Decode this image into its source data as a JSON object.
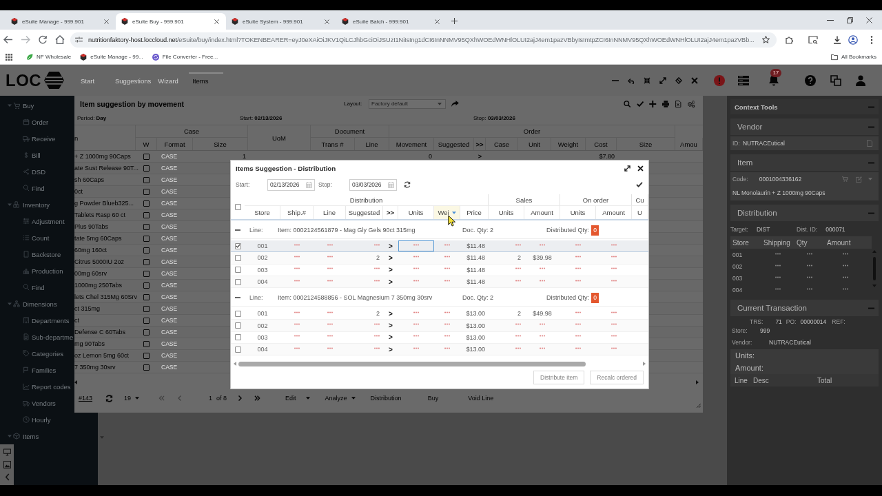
{
  "browser": {
    "tabs": [
      {
        "title": "eSuite Manage - 999:901",
        "selected": false
      },
      {
        "title": "eSuite Buy - 999:901",
        "selected": true
      },
      {
        "title": "eSuite System - 999:901",
        "selected": false
      },
      {
        "title": "eSuite Batch - 999:901",
        "selected": false
      }
    ],
    "address": {
      "host": "nutritionfaktory-host.loccloud.net",
      "path": "/eSuite/buy/index.html?TOKENBEARER=eyJ0eXAiOiJKV1QiLCJhbGciOiJSUzI1NiIsIng1dCI6InNNMV95QXhWOEdWNHlOLUI2ajJ4em1pazVBbyIsImtpZCI6InNNMV95QXhWOEdWNHlOLUI2ajJ4em1pazVBb..."
    },
    "bookmarks": [
      {
        "label": "NF Wholesale",
        "kind": "leaf"
      },
      {
        "label": "eSuite Manage - 99...",
        "kind": "hexagon"
      },
      {
        "label": "File Converter - Free...",
        "kind": "arrows"
      }
    ],
    "all_bookmarks": "All Bookmarks"
  },
  "app": {
    "logo": "LOC",
    "notification_count": "17"
  },
  "sidebar": [
    {
      "label": "Buy",
      "expanded": true,
      "children": [
        {
          "label": "Order"
        },
        {
          "label": "Receive"
        },
        {
          "label": "Bill"
        },
        {
          "label": "DSD"
        },
        {
          "label": "Find"
        }
      ]
    },
    {
      "label": "Inventory",
      "expanded": true,
      "children": [
        {
          "label": "Adjustment"
        },
        {
          "label": "Count"
        },
        {
          "label": "Backstore"
        },
        {
          "label": "Production"
        },
        {
          "label": "Find"
        }
      ]
    },
    {
      "label": "Dimensions",
      "expanded": true,
      "children": [
        {
          "label": "Departments"
        },
        {
          "label": "Sub-departme"
        },
        {
          "label": "Categories"
        },
        {
          "label": "Families"
        },
        {
          "label": "Report codes"
        },
        {
          "label": "Vendors"
        },
        {
          "label": "Hourly"
        }
      ]
    },
    {
      "label": "Items",
      "expanded": true
    }
  ],
  "window": {
    "tabs": [
      {
        "label": "Start",
        "selected": false
      },
      {
        "label": "Suggestions",
        "selected": false
      },
      {
        "label": "Wizard",
        "selected": false
      },
      {
        "label": "Items",
        "selected": true
      }
    ],
    "title": "Item suggestion by movement",
    "layout": {
      "label": "Layout:",
      "value": "Factory default",
      "disabled": true
    },
    "period": {
      "label": "Period:",
      "value": "Day"
    },
    "start": {
      "label": "Start:",
      "value": "02/13/2026"
    },
    "stop": {
      "label": "Stop:",
      "value": "03/03/2026"
    },
    "table": {
      "columns": [
        {
          "label": "n"
        },
        {
          "label": "Case",
          "children": [
            {
              "label": "W"
            },
            {
              "label": "Format"
            },
            {
              "label": "Size"
            }
          ]
        },
        {
          "label": "UoM"
        },
        {
          "label": "Document",
          "children": [
            {
              "label": "Trans #"
            },
            {
              "label": "Line"
            }
          ]
        },
        {
          "label": "Order",
          "children": [
            {
              "label": "Movement"
            },
            {
              "label": "Suggested"
            },
            {
              "label": ">>"
            },
            {
              "label": "Case"
            },
            {
              "label": "Unit"
            },
            {
              "label": "Weight"
            },
            {
              "label": "Cost"
            },
            {
              "label": "Size"
            }
          ]
        },
        {
          "children": [
            {
              "label": "Amou"
            }
          ]
        }
      ],
      "rows": [
        {
          "description": "+ Z 1000mg 90Caps",
          "checked": false,
          "format": "CASE",
          "size": "1",
          "movement": "0",
          "expand": ">",
          "cost": "$7.80"
        },
        {
          "description": "ate Sust Release 90T...",
          "checked": false,
          "format": "CASE"
        },
        {
          "description": "sh 60Caps",
          "checked": false,
          "format": "CASE"
        },
        {
          "description": "0ct",
          "checked": false,
          "format": "CASE"
        },
        {
          "description": "g Powder Blueb325...",
          "checked": false,
          "format": "CASE"
        },
        {
          "description": "Tablets Rasp 60 ct",
          "checked": false,
          "format": "CASE"
        },
        {
          "description": "Plus 90Tabs",
          "checked": false,
          "format": "CASE"
        },
        {
          "description": "tate 5mg 60Caps",
          "checked": false,
          "format": "CASE"
        },
        {
          "description": "60mg 160ct",
          "checked": false,
          "format": "CASE"
        },
        {
          "description": "Citrus 5000IU 2oz",
          "checked": false,
          "format": "CASE"
        },
        {
          "description": "00mg 60srv",
          "checked": false,
          "format": "CASE"
        },
        {
          "description": "1000mg 250Tabs",
          "checked": false,
          "format": "CASE"
        },
        {
          "description": "lets Chel 315Mg 60Srv",
          "checked": false,
          "format": "CASE"
        },
        {
          "description": "ct 315mg",
          "checked": false,
          "format": "CASE"
        },
        {
          "description": "ct",
          "checked": false,
          "format": "CASE"
        },
        {
          "description": "Defense C 60Tabs",
          "checked": false,
          "format": "CASE"
        },
        {
          "description": "mg 90Tabs",
          "checked": false,
          "format": "CASE"
        },
        {
          "description": "oz Lemon 5mg 60ct",
          "checked": false,
          "format": "CASE"
        },
        {
          "description": "7 350mg 30srv",
          "checked": false,
          "format": "CASE"
        }
      ]
    },
    "footer": {
      "record": "#143",
      "page_size": "19",
      "page": "1",
      "page_count": "of 8",
      "menus": [
        {
          "label": "Edit",
          "dropdown": true
        },
        {
          "label": "Analyze",
          "dropdown": true
        },
        {
          "label": "Distribution",
          "dropdown": false
        },
        {
          "label": "Buy",
          "dropdown": false
        },
        {
          "label": "Void Line",
          "dropdown": false
        }
      ]
    }
  },
  "dialog": {
    "title": "Items Suggestion - Distribution",
    "start": {
      "label": "Start:",
      "value": "02/13/2026"
    },
    "stop": {
      "label": "Stop:",
      "value": "03/03/2026"
    },
    "select_all_checked": false,
    "columns": [
      {
        "label": "Distribution",
        "children": [
          {
            "label": "Store",
            "hovered": false
          },
          {
            "label": "Ship.#",
            "hovered": false
          },
          {
            "label": "Line",
            "hovered": false
          },
          {
            "label": "Suggested",
            "hovered": false
          },
          {
            "label": ">>",
            "hovered": false
          },
          {
            "label": "Units",
            "hovered": false
          },
          {
            "label": "Wei",
            "hovered": true
          },
          {
            "label": "Price",
            "hovered": false
          }
        ]
      },
      {
        "label": "Sales",
        "children": [
          {
            "label": "Units",
            "hovered": false
          },
          {
            "label": "Amount",
            "hovered": false
          }
        ]
      },
      {
        "label": "On order",
        "children": [
          {
            "label": "Units",
            "hovered": false
          },
          {
            "label": "Amount",
            "hovered": false
          }
        ]
      },
      {
        "label": "Cu",
        "children": [
          {
            "label": "U",
            "hovered": false
          }
        ]
      }
    ],
    "groups": [
      {
        "expanded": true,
        "line_label": "Line:",
        "item": "Item: 0002124561879 - Mag Gly Gels 90ct 315mg",
        "doc_qty": "Doc. Qty: 2",
        "distributed_label": "Distributed Qty:",
        "distributed": "0",
        "rows": [
          {
            "checked": true,
            "selected": true,
            "cells": [
              "001",
              null,
              null,
              null,
              ">",
              {
                "focused": true
              },
              null,
              "$11.48",
              null,
              null,
              null,
              null
            ]
          },
          {
            "checked": false,
            "selected": false,
            "cells": [
              "002",
              null,
              null,
              "2",
              ">",
              null,
              null,
              "$11.48",
              "2",
              "$39.98",
              null,
              null
            ]
          },
          {
            "checked": false,
            "selected": false,
            "cells": [
              "003",
              null,
              null,
              null,
              ">",
              null,
              null,
              "$11.48",
              null,
              null,
              null,
              null
            ]
          },
          {
            "checked": false,
            "selected": false,
            "cells": [
              "004",
              null,
              null,
              null,
              ">",
              null,
              null,
              "$11.48",
              null,
              null,
              null,
              null
            ]
          }
        ]
      },
      {
        "expanded": true,
        "line_label": "Line:",
        "item": "Item: 0002124588856 - SOL Magnesium 7 350mg 30srv",
        "doc_qty": "Doc. Qty: 2",
        "distributed_label": "Distributed Qty:",
        "distributed": "0",
        "rows": [
          {
            "checked": false,
            "selected": false,
            "cells": [
              "001",
              null,
              null,
              "2",
              ">",
              null,
              null,
              "$13.00",
              "2",
              "$49.98",
              null,
              null
            ]
          },
          {
            "checked": false,
            "selected": false,
            "cells": [
              "002",
              null,
              null,
              null,
              ">",
              null,
              null,
              "$13.00",
              null,
              null,
              null,
              null
            ]
          },
          {
            "checked": false,
            "selected": false,
            "cells": [
              "003",
              null,
              null,
              null,
              ">",
              null,
              null,
              "$13.00",
              null,
              null,
              null,
              null
            ]
          },
          {
            "checked": false,
            "selected": false,
            "cells": [
              "004",
              null,
              null,
              null,
              ">",
              null,
              null,
              "$13.00",
              null,
              null,
              null,
              null
            ]
          }
        ]
      }
    ],
    "buttons": [
      {
        "label": "Distribute item",
        "disabled": true
      },
      {
        "label": "Recalc ordered",
        "disabled": true
      }
    ]
  },
  "context_tools": {
    "title": "Context Tools",
    "expanded": true,
    "vendor": {
      "title": "Vendor",
      "expanded": true,
      "id_label": "ID:",
      "id": "NUTRACEutical"
    },
    "item": {
      "title": "Item",
      "expanded": true,
      "code_label": "Code:",
      "code": "0001004336162",
      "description": "NL Monolaurin + Z 1000mg 90Caps"
    },
    "distribution": {
      "title": "Distribution",
      "expanded": true,
      "target_label": "Target:",
      "target": "DIST",
      "dist_id_label": "Dist. ID:",
      "dist_id": "000071",
      "columns": [
        "Store",
        "Shipping",
        "Qty",
        "Amount"
      ],
      "rows": [
        [
          "001",
          null,
          null,
          null
        ],
        [
          "002",
          null,
          null,
          null
        ],
        [
          "003",
          null,
          null,
          null
        ],
        [
          "004",
          null,
          null,
          null
        ]
      ]
    },
    "transaction": {
      "title": "Current Transaction",
      "expanded": true,
      "trs_label": "TRS:",
      "trs": "71",
      "po_label": "PO:",
      "po": "00000014",
      "ref_label": "REF:",
      "store_label": "Store:",
      "store": "999",
      "vendor_label": "Vendor:",
      "vendor": "NUTRACEutical",
      "units_label": "Units:",
      "amount_label": "Amount:",
      "columns": [
        "Line",
        "Desc",
        "Total"
      ]
    }
  }
}
